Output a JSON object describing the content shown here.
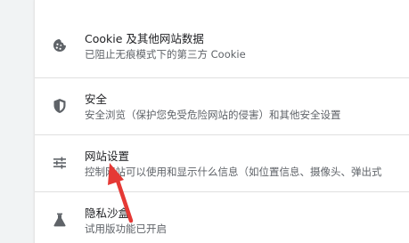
{
  "settings": {
    "rows": [
      {
        "icon": "cookie-icon",
        "title": "Cookie 及其他网站数据",
        "subtitle": "已阻止无痕模式下的第三方 Cookie"
      },
      {
        "icon": "shield-icon",
        "title": "安全",
        "subtitle": "安全浏览（保护您免受危险网站的侵害）和其他安全设置"
      },
      {
        "icon": "sliders-icon",
        "title": "网站设置",
        "subtitle": "控制网站可以使用和显示什么信息（如位置信息、摄像头、弹出式"
      },
      {
        "icon": "flask-icon",
        "title": "隐私沙盒",
        "subtitle": "试用版功能已开启"
      }
    ]
  },
  "annotation": {
    "icon": "red-arrow-icon",
    "color": "#e53935"
  }
}
